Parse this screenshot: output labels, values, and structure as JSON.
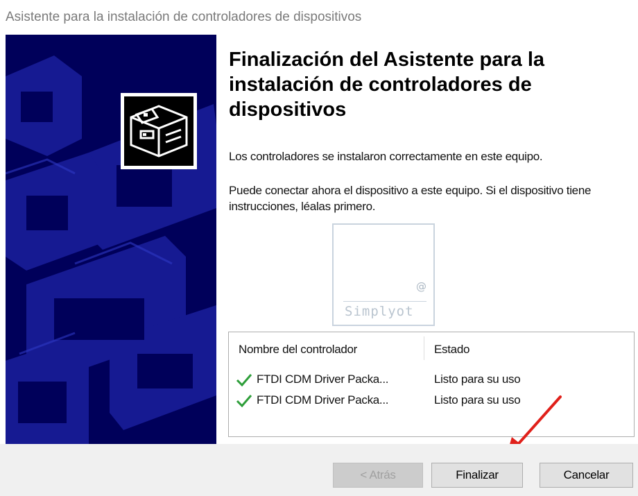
{
  "window": {
    "title": "Asistente para la instalación de controladores de dispositivos"
  },
  "banner": {
    "icon": "driver-box-icon"
  },
  "main": {
    "heading": "Finalización del Asistente para la instalación de controladores de dispositivos",
    "message1": "Los controladores se instalaron correctamente en este equipo.",
    "message2": "Puede conectar ahora el dispositivo a este equipo. Si el dispositivo tiene instrucciones, léalas primero."
  },
  "watermark": {
    "symbol": "@",
    "text": "Simplyot"
  },
  "driver_list": {
    "columns": [
      "Nombre del controlador",
      "Estado"
    ],
    "rows": [
      {
        "name": "FTDI CDM Driver Packa...",
        "status": "Listo para su uso",
        "icon": "check-icon"
      },
      {
        "name": "FTDI CDM Driver Packa...",
        "status": "Listo para su uso",
        "icon": "check-icon"
      }
    ]
  },
  "footer": {
    "back_label": "< Atrás",
    "finish_label": "Finalizar",
    "cancel_label": "Cancelar"
  },
  "colors": {
    "banner": "#00005a",
    "check": "#2e9e3a",
    "annotation_arrow": "#e0201a"
  }
}
